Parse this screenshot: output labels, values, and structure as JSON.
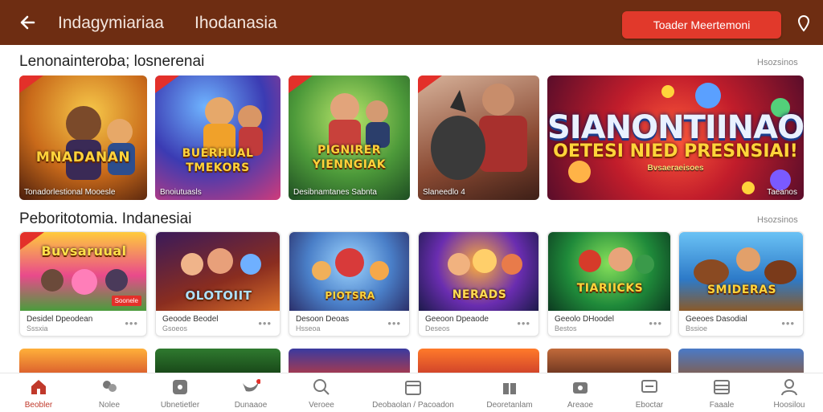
{
  "header": {
    "title_left": "Indagymiariaa",
    "title_right": "Ihodanasia",
    "cta_label": "Toader Meertemoni",
    "colors": {
      "bar": "#6e2d12",
      "cta": "#e1392b"
    }
  },
  "section1": {
    "title": "Lenonainteroba; losnerenai",
    "more": "Hsozsinos",
    "cards": [
      {
        "title": "MNADANAN",
        "caption": "Tonadorlestional Mooesle"
      },
      {
        "title": "BUERHUAL TMEKORS",
        "caption": "Bnoiutuasls"
      },
      {
        "title": "PIGNIRER YIENNGIAK",
        "caption": "Desibnamtanes Sabnta"
      },
      {
        "title": "",
        "caption": "Slaneedlo 4"
      }
    ],
    "hero": {
      "line1": "SIANONTIINAO!",
      "line2": "OETESI NIED PRESNSIAI!",
      "line3": "Bvsaeraeisoes",
      "caption": "Taeanos"
    }
  },
  "section2": {
    "title": "Peboritotomia. Indanesiai",
    "more": "Hsozsinos",
    "cards": [
      {
        "title": "Buvsaruual",
        "name": "Desidel Dpeodean",
        "sub": "Sssxia",
        "tag": "Soonele"
      },
      {
        "title": "OLOTOIIT",
        "name": "Geoode Beodel",
        "sub": "Gsoeos",
        "tag": ""
      },
      {
        "title": "PIOTSRA",
        "name": "Desoon Deoas",
        "sub": "Hsseoa",
        "tag": ""
      },
      {
        "title": "NERADS",
        "name": "Geeoon Dpeaode",
        "sub": "Deseos",
        "tag": ""
      },
      {
        "title": "TIARIICKS",
        "name": "Geeolo DHoodel",
        "sub": "Bestos",
        "tag": ""
      },
      {
        "title": "SMIDERAS",
        "name": "Geeoes Dasodial",
        "sub": "Bssioe",
        "tag": ""
      }
    ]
  },
  "bottom_nav": [
    {
      "label": "Beobler",
      "icon": "home-icon",
      "active": true
    },
    {
      "label": "Nolee",
      "icon": "community-icon",
      "active": false
    },
    {
      "label": "Ubnetietler",
      "icon": "square-icon",
      "active": false
    },
    {
      "label": "Dunaaoe",
      "icon": "bird-icon",
      "active": false
    },
    {
      "label": "Veroee",
      "icon": "search-icon",
      "active": false
    },
    {
      "label": "Deobaolan / Pacoadon",
      "icon": "box-icon",
      "active": false
    },
    {
      "label": "Deoretanlam",
      "icon": "gift-icon",
      "active": false
    },
    {
      "label": "Areaoe",
      "icon": "camera-icon",
      "active": false
    },
    {
      "label": "Eboctar",
      "icon": "message-icon",
      "active": false
    },
    {
      "label": "Faaale",
      "icon": "card-icon",
      "active": false
    },
    {
      "label": "Hoosilou",
      "icon": "profile-icon",
      "active": false
    }
  ]
}
